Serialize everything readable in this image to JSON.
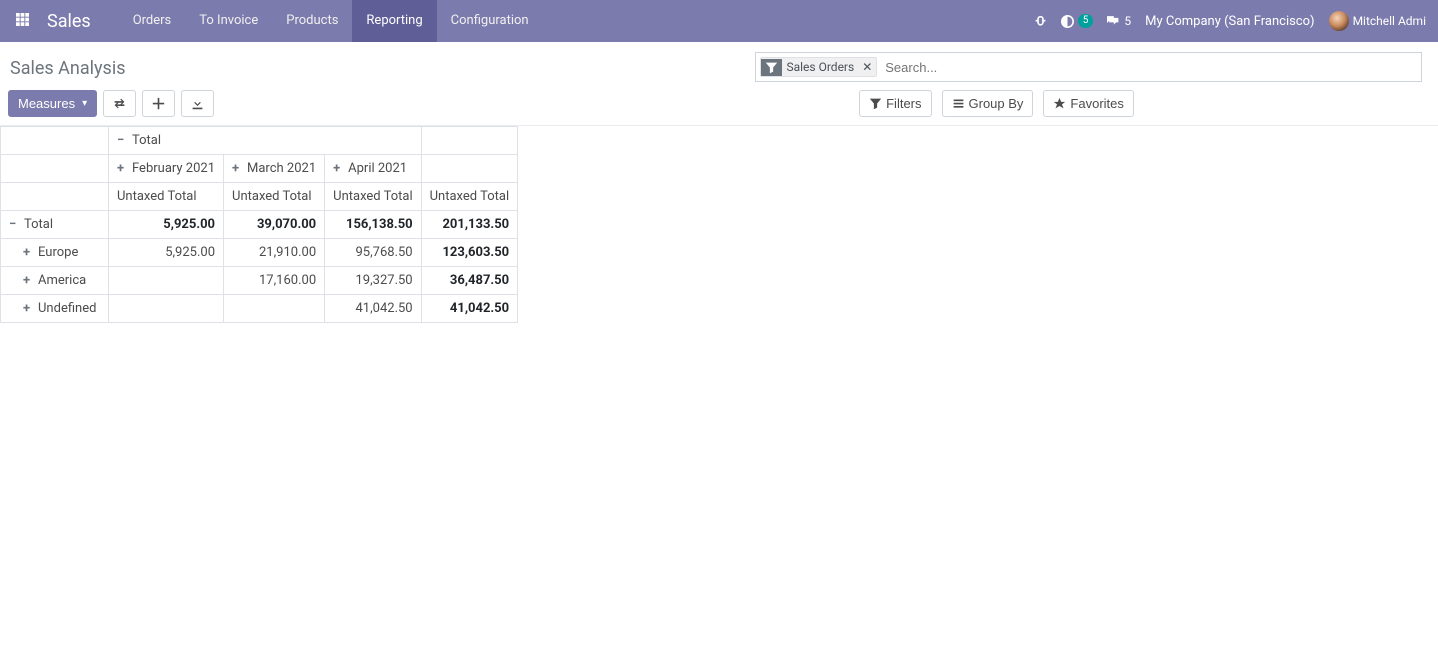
{
  "navbar": {
    "brand": "Sales",
    "menu": [
      "Orders",
      "To Invoice",
      "Products",
      "Reporting",
      "Configuration"
    ],
    "active_index": 3,
    "company": "My Company (San Francisco)",
    "user": "Mitchell Admi",
    "badge_clock": "5",
    "badge_chat": "5"
  },
  "control_panel": {
    "title": "Sales Analysis",
    "measures_label": "Measures",
    "search_placeholder": "Search...",
    "active_filter": "Sales Orders",
    "filters_label": "Filters",
    "groupby_label": "Group By",
    "favorites_label": "Favorites"
  },
  "pivot": {
    "measure_label": "Untaxed Total",
    "col_total_label": "Total",
    "columns": [
      "February 2021",
      "March 2021",
      "April 2021"
    ],
    "rows": [
      {
        "label": "Total",
        "level": 0,
        "expanded": true,
        "values": [
          "5,925.00",
          "39,070.00",
          "156,138.50"
        ],
        "total": "201,133.50",
        "bold": true
      },
      {
        "label": "Europe",
        "level": 1,
        "expanded": false,
        "values": [
          "5,925.00",
          "21,910.00",
          "95,768.50"
        ],
        "total": "123,603.50",
        "bold": false
      },
      {
        "label": "America",
        "level": 1,
        "expanded": false,
        "values": [
          "",
          "17,160.00",
          "19,327.50"
        ],
        "total": "36,487.50",
        "bold": false
      },
      {
        "label": "Undefined",
        "level": 1,
        "expanded": false,
        "values": [
          "",
          "",
          "41,042.50"
        ],
        "total": "41,042.50",
        "bold": false
      }
    ]
  }
}
